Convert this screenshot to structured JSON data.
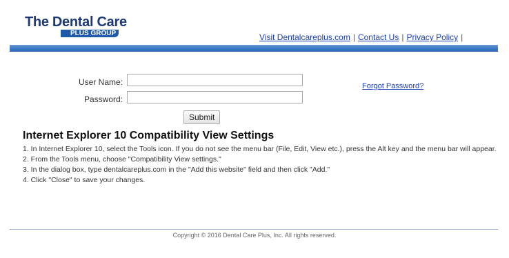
{
  "header": {
    "logo_title": "The Dental Care",
    "logo_subtitle": "PLUS GROUP",
    "links": [
      {
        "label": "Visit Dentalcareplus.com"
      },
      {
        "label": "Contact Us"
      },
      {
        "label": "Privacy Policy"
      }
    ],
    "separator": "|"
  },
  "login_form": {
    "username_label": "User Name:",
    "username_value": "",
    "password_label": "Password:",
    "password_value": "",
    "submit_label": "Submit",
    "forgot_password_label": "Forgot Password?"
  },
  "instructions": {
    "heading": "Internet Explorer 10 Compatibility View Settings",
    "steps": [
      "1. In Internet Explorer 10, select the Tools icon. If you do not see the menu bar (File, Edit, View etc.), press the Alt key and the menu bar will appear.",
      "2. From the Tools menu, choose \"Compatibility View settings.\"",
      "3. In the dialog box, type dentalcareplus.com in the \"Add this website\" field and then click \"Add.\"",
      "4. Click \"Close\" to save your changes."
    ]
  },
  "footer": {
    "copyright": "Copyright © 2016 Dental Care Plus, Inc. All rights reserved."
  },
  "colors": {
    "logo_blue": "#1e3a78",
    "link_blue": "#1a3db8",
    "header_bar": "#3a77c4"
  }
}
